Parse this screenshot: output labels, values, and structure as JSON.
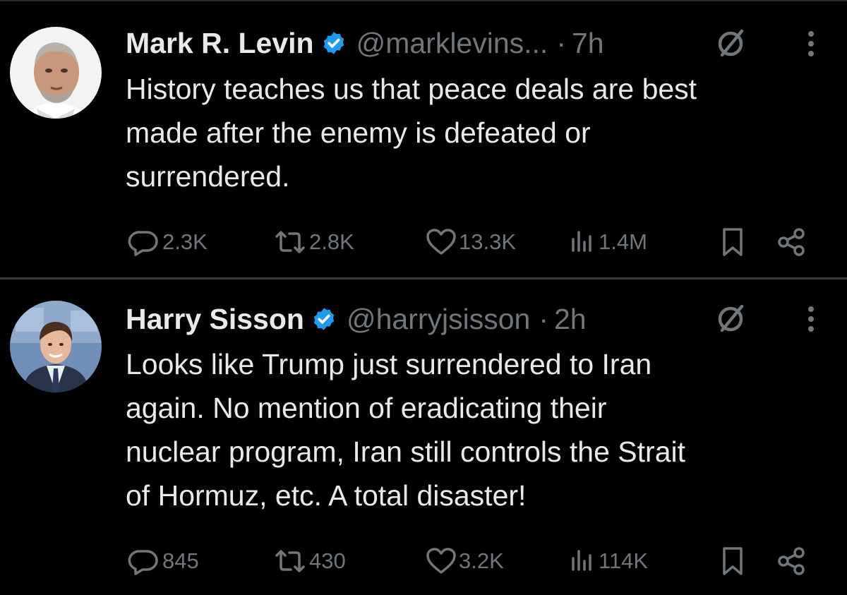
{
  "tweets": [
    {
      "author": {
        "name": "Mark R. Levin",
        "handle": "@marklevins...",
        "time": "7h",
        "verified": true
      },
      "text_lines": [
        "History teaches us that peace deals are best",
        "made after the enemy is defeated or",
        "surrendered."
      ],
      "stats": {
        "replies": "2.3K",
        "retweets": "2.8K",
        "likes": "13.3K",
        "views": "1.4M"
      }
    },
    {
      "author": {
        "name": "Harry Sisson",
        "handle": "@harryjsisson",
        "time": "2h",
        "verified": true
      },
      "text_lines": [
        "Looks like Trump just surrendered to Iran",
        "again. No mention of eradicating their",
        "nuclear program, Iran still controls the Strait",
        "of Hormuz, etc. A total disaster!"
      ],
      "stats": {
        "replies": "845",
        "retweets": "430",
        "likes": "3.2K",
        "views": "114K"
      }
    }
  ],
  "ui": {
    "separator": "·",
    "colors": {
      "background": "#000000",
      "primary_text": "#e7e9ea",
      "secondary_text": "#71767b",
      "verified_badge": "#1d9bf0",
      "divider": "#3b3f43"
    },
    "icons": [
      "verified-badge-icon",
      "grok-icon",
      "more-icon",
      "reply-icon",
      "retweet-icon",
      "like-icon",
      "views-icon",
      "bookmark-icon",
      "share-icon"
    ]
  }
}
